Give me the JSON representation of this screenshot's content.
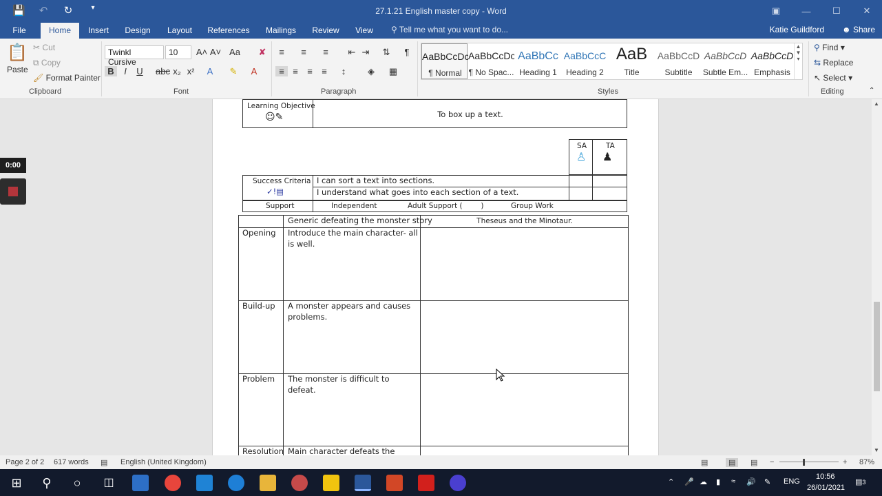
{
  "window": {
    "title": "27.1.21 English master copy - Word",
    "controls": [
      "—",
      "☐",
      "✕"
    ]
  },
  "tabs": [
    {
      "label": "File"
    },
    {
      "label": "Home"
    },
    {
      "label": "Insert"
    },
    {
      "label": "Design"
    },
    {
      "label": "Layout"
    },
    {
      "label": "References"
    },
    {
      "label": "Mailings"
    },
    {
      "label": "Review"
    },
    {
      "label": "View"
    }
  ],
  "tell_me": "Tell me what you want to do...",
  "user": "Katie Guildford",
  "share": "Share",
  "clipboard": {
    "paste": "Paste",
    "cut": "Cut",
    "copy": "Copy",
    "format_painter": "Format Painter",
    "label": "Clipboard"
  },
  "font": {
    "name": "Twinkl Cursive",
    "size": "10",
    "label": "Font"
  },
  "paragraph": {
    "label": "Paragraph"
  },
  "styles": {
    "label": "Styles",
    "items": [
      {
        "sample": "AaBbCcDc",
        "name": "¶ Normal"
      },
      {
        "sample": "AaBbCcDc",
        "name": "¶ No Spac..."
      },
      {
        "sample": "AaBbCc",
        "name": "Heading 1"
      },
      {
        "sample": "AaBbCcC",
        "name": "Heading 2"
      },
      {
        "sample": "AaB",
        "name": "Title"
      },
      {
        "sample": "AaBbCcD",
        "name": "Subtitle"
      },
      {
        "sample": "AaBbCcD",
        "name": "Subtle Em..."
      },
      {
        "sample": "AaBbCcD",
        "name": "Emphasis"
      }
    ]
  },
  "editing": {
    "find": "Find",
    "replace": "Replace",
    "select": "Select",
    "label": "Editing"
  },
  "recording": {
    "timer": "0:00"
  },
  "document": {
    "learning_objective_label": "Learning Objective",
    "learning_objective": "To box up a text.",
    "sa": "SA",
    "ta": "TA",
    "success_criteria_label": "Success Criteria",
    "criteria": [
      "I can sort a text into sections.",
      "I understand what goes into each section of a text."
    ],
    "support_row": [
      "Support",
      "Independent",
      "Adult Support (        )",
      "Group Work"
    ],
    "table_header": [
      "",
      "Generic defeating the monster story",
      "Theseus and the Minotaur."
    ],
    "rows": [
      {
        "section": "Opening",
        "generic": "Introduce the main character- all is well."
      },
      {
        "section": "Build-up",
        "generic": "A monster appears and causes problems."
      },
      {
        "section": "Problem",
        "generic": "The monster is difficult to defeat."
      },
      {
        "section": "Resolution",
        "generic": "Main character defeats the"
      }
    ]
  },
  "status": {
    "page": "Page 2 of 2",
    "words": "617 words",
    "language": "English (United Kingdom)",
    "zoom": "87%"
  },
  "taskbar": {
    "time": "10:56",
    "date": "26/01/2021",
    "lang": "ENG",
    "notifications": "3"
  }
}
